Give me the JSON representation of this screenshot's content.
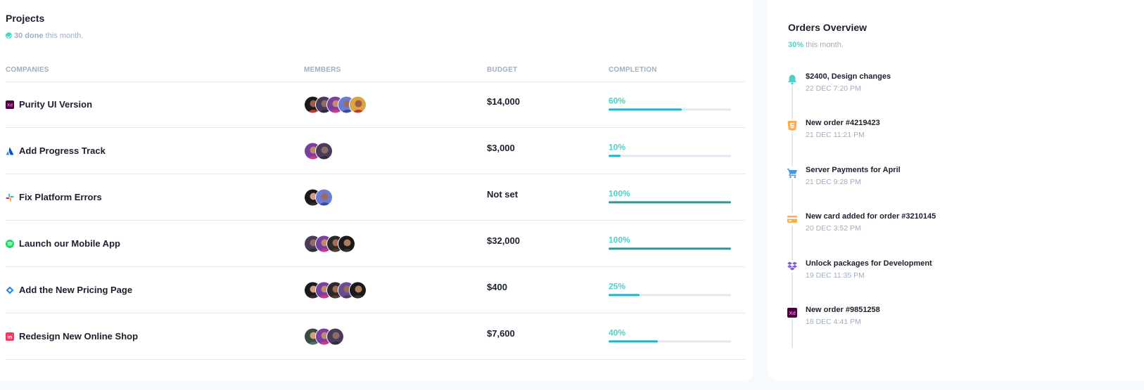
{
  "projects": {
    "title": "Projects",
    "done_count": "30 done",
    "done_suffix": "this month.",
    "columns": [
      "COMPANIES",
      "MEMBERS",
      "BUDGET",
      "COMPLETION"
    ],
    "rows": [
      {
        "name": "Purity UI Version",
        "logo": "adobe-xd-icon",
        "budget": "$14,000",
        "completion": "60%",
        "completion_value": 60,
        "members": 5
      },
      {
        "name": "Add Progress Track",
        "logo": "atlassian-icon",
        "budget": "$3,000",
        "completion": "10%",
        "completion_value": 10,
        "members": 2
      },
      {
        "name": "Fix Platform Errors",
        "logo": "slack-icon",
        "budget": "Not set",
        "completion": "100%",
        "completion_value": 100,
        "members": 2
      },
      {
        "name": "Launch our Mobile App",
        "logo": "spotify-icon",
        "budget": "$32,000",
        "completion": "100%",
        "completion_value": 100,
        "members": 4
      },
      {
        "name": "Add the New Pricing Page",
        "logo": "jira-icon",
        "budget": "$400",
        "completion": "25%",
        "completion_value": 25,
        "members": 5
      },
      {
        "name": "Redesign New Online Shop",
        "logo": "invision-icon",
        "budget": "$7,600",
        "completion": "40%",
        "completion_value": 40,
        "members": 3
      }
    ]
  },
  "orders": {
    "title": "Orders Overview",
    "percent": "30%",
    "percent_suffix": "this month.",
    "items": [
      {
        "title": "$2400, Design changes",
        "date": "22 DEC 7:20 PM",
        "icon": "bell-icon",
        "color": "#4fd1c5"
      },
      {
        "title": "New order #4219423",
        "date": "21 DEC 11:21 PM",
        "icon": "html5-icon",
        "color": "#f6ad55"
      },
      {
        "title": "Server Payments for April",
        "date": "21 DEC 9:28 PM",
        "icon": "cart-icon",
        "color": "#4299e1"
      },
      {
        "title": "New card added for order #3210145",
        "date": "20 DEC 3:52 PM",
        "icon": "credit-card-icon",
        "color": "#f6ad55"
      },
      {
        "title": "Unlock packages for Development",
        "date": "19 DEC 11:35 PM",
        "icon": "dropbox-icon",
        "color": "#805ad5"
      },
      {
        "title": "New order #9851258",
        "date": "18 DEC 4:41 PM",
        "icon": "adobe-xd-icon",
        "color": "#470137"
      }
    ]
  },
  "colors": {
    "accent": "#4fd1c5",
    "progress": "#20b2c9",
    "progress_complete": "#319795"
  }
}
